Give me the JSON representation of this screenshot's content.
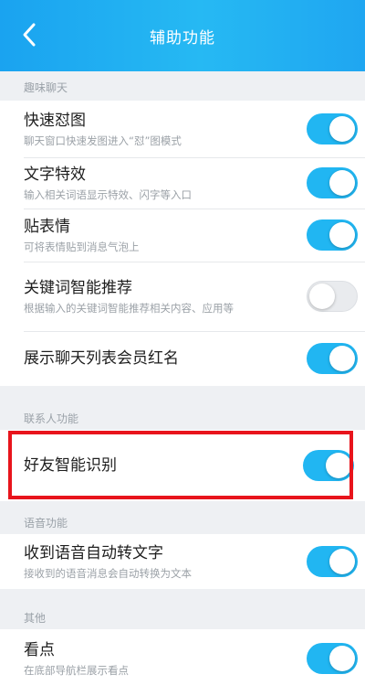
{
  "header": {
    "title": "辅助功能"
  },
  "sections": {
    "fun_chat": "趣味聊天",
    "contacts": "联系人功能",
    "voice": "语音功能",
    "other": "其他"
  },
  "items": {
    "quick_meme": {
      "label": "快速怼图",
      "desc": "聊天窗口快速发图进入“怼”图模式",
      "on": true
    },
    "text_effects": {
      "label": "文字特效",
      "desc": "输入相关词语显示特效、闪字等入口",
      "on": true
    },
    "sticker": {
      "label": "贴表情",
      "desc": "可将表情贴到消息气泡上",
      "on": true
    },
    "keyword_recommend": {
      "label": "关键词智能推荐",
      "desc": "根据输入的关键词智能推荐相关内容、应用等",
      "on": false
    },
    "show_chat_list_red_name": {
      "label": "展示聊天列表会员红名",
      "on": true
    },
    "smart_recognition": {
      "label": "好友智能识别",
      "on": true
    },
    "voice_to_text": {
      "label": "收到语音自动转文字",
      "desc": "接收到的语音消息会自动转换为文本",
      "on": true
    },
    "kandian": {
      "label": "看点",
      "desc": "在底部导航栏展示看点",
      "on": true
    }
  },
  "colors": {
    "accent": "#21b6f2",
    "highlight": "#e8141c",
    "header": "#1aa3f0"
  },
  "icons": {
    "back": "chevron-left-icon"
  }
}
